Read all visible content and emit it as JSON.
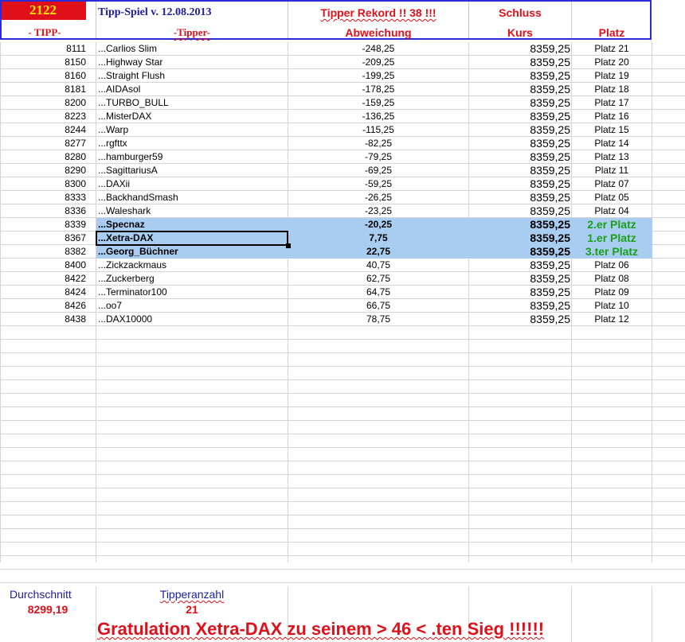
{
  "header": {
    "count": "2122",
    "title": "Tipp-Spiel v. 12.08.2013",
    "record": "Tipper Rekord !!  38  !!!",
    "schluss": "Schluss",
    "col_tipp": "- TIPP-",
    "col_tipper": "-Tipper-",
    "col_abw": "Abweichung",
    "col_kurs": "Kurs",
    "col_platz": "Platz"
  },
  "rows": [
    {
      "tipp": "8111",
      "tipper": "...Carlios Slim",
      "abw": "-248,25",
      "kurs": "8359,25",
      "platz": "Platz 21"
    },
    {
      "tipp": "8150",
      "tipper": "...Highway Star",
      "abw": "-209,25",
      "kurs": "8359,25",
      "platz": "Platz 20"
    },
    {
      "tipp": "8160",
      "tipper": "...Straight Flush",
      "abw": "-199,25",
      "kurs": "8359,25",
      "platz": "Platz 19"
    },
    {
      "tipp": "8181",
      "tipper": "...AIDAsol",
      "abw": "-178,25",
      "kurs": "8359,25",
      "platz": "Platz 18"
    },
    {
      "tipp": "8200",
      "tipper": "...TURBO_BULL",
      "abw": "-159,25",
      "kurs": "8359,25",
      "platz": "Platz 17"
    },
    {
      "tipp": "8223",
      "tipper": "...MisterDAX",
      "abw": "-136,25",
      "kurs": "8359,25",
      "platz": "Platz 16"
    },
    {
      "tipp": "8244",
      "tipper": "...Warp",
      "abw": "-115,25",
      "kurs": "8359,25",
      "platz": "Platz 15"
    },
    {
      "tipp": "8277",
      "tipper": "...rgfttx",
      "abw": "-82,25",
      "kurs": "8359,25",
      "platz": "Platz 14"
    },
    {
      "tipp": "8280",
      "tipper": "...hamburger59",
      "abw": "-79,25",
      "kurs": "8359,25",
      "platz": "Platz 13"
    },
    {
      "tipp": "8290",
      "tipper": "...SagittariusA",
      "abw": "-69,25",
      "kurs": "8359,25",
      "platz": "Platz 11"
    },
    {
      "tipp": "8300",
      "tipper": "...DAXii",
      "abw": "-59,25",
      "kurs": "8359,25",
      "platz": "Platz 07"
    },
    {
      "tipp": "8333",
      "tipper": "...BackhandSmash",
      "abw": "-26,25",
      "kurs": "8359,25",
      "platz": "Platz 05"
    },
    {
      "tipp": "8336",
      "tipper": "...Waleshark",
      "abw": "-23,25",
      "kurs": "8359,25",
      "platz": "Platz 04"
    },
    {
      "tipp": "8339",
      "tipper": "...Specnaz",
      "abw": "-20,25",
      "kurs": "8359,25",
      "platz": "2.er Platz",
      "hl": true
    },
    {
      "tipp": "8367",
      "tipper": "...Xetra-DAX",
      "abw": "7,75",
      "kurs": "8359,25",
      "platz": "1.er Platz",
      "hl": true
    },
    {
      "tipp": "8382",
      "tipper": "...Georg_Büchner",
      "abw": "22,75",
      "kurs": "8359,25",
      "platz": "3.ter Platz",
      "hl": true
    },
    {
      "tipp": "8400",
      "tipper": "...Zickzackmaus",
      "abw": "40,75",
      "kurs": "8359,25",
      "platz": "Platz 06"
    },
    {
      "tipp": "8422",
      "tipper": "...Zuckerberg",
      "abw": "62,75",
      "kurs": "8359,25",
      "platz": "Platz 08"
    },
    {
      "tipp": "8424",
      "tipper": "...Terminator100",
      "abw": "64,75",
      "kurs": "8359,25",
      "platz": "Platz 09"
    },
    {
      "tipp": "8426",
      "tipper": "...oo7",
      "abw": "66,75",
      "kurs": "8359,25",
      "platz": "Platz 10"
    },
    {
      "tipp": "8438",
      "tipper": "...DAX10000",
      "abw": "78,75",
      "kurs": "8359,25",
      "platz": "Platz 12"
    }
  ],
  "footer": {
    "avg_label": "Durchschnitt",
    "avg_value": "8299,19",
    "count_label": "Tipperanzahl",
    "count_value": "21",
    "congrats": "Gratulation Xetra-DAX zu seinem > 46 < .ten Sieg !!!!!!"
  },
  "colors": {
    "accent_red": "#e0101a",
    "navy": "#1d1d9c",
    "highlight": "#a9cdf0",
    "winner_green": "#1aa01a"
  }
}
